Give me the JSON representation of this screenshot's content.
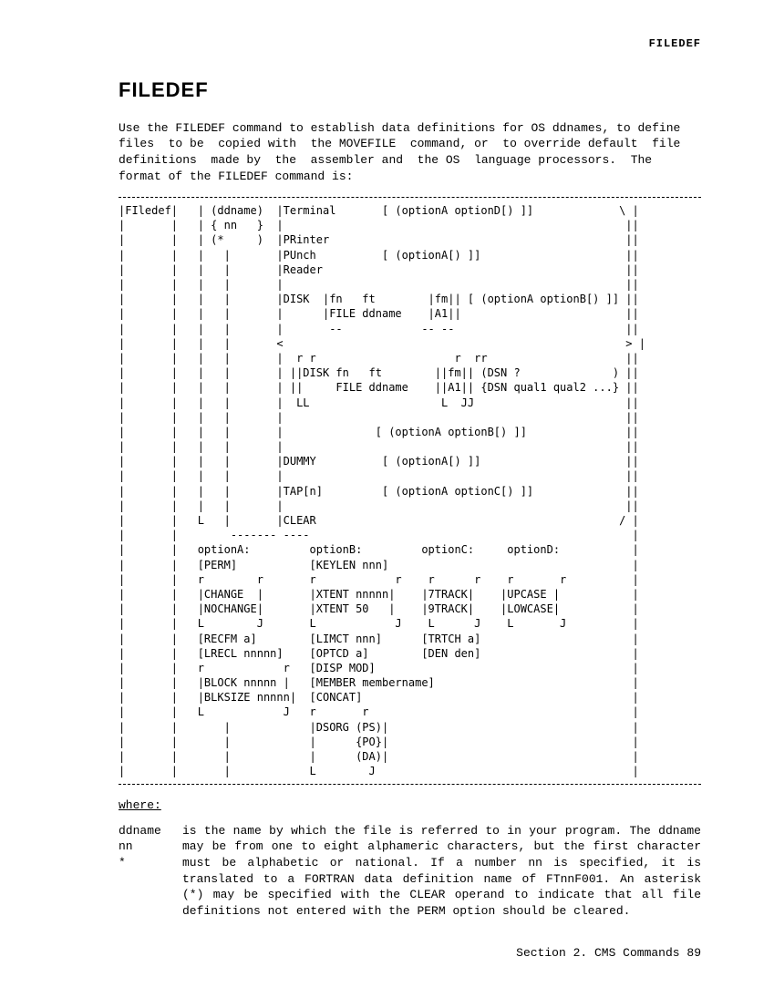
{
  "running_head": "FILEDEF",
  "title": "FILEDEF",
  "intro": "Use the FILEDEF command to establish data definitions for OS ddnames, to define files  to be  copied with  the MOVEFILE  command, or  to override default  file definitions  made by  the  assembler and  the OS  language processors.  The format of the FILEDEF command is:",
  "syntax": "|FIledef|   | (ddname)  |Terminal       [ (optionA optionD[) ]]             \\ |\n|       |   | { nn   }  |                                                    ||\n|       |   | (*     )  |PRinter                                             ||\n|       |   |   |       |PUnch          [ (optionA[) ]]                      ||\n|       |   |   |       |Reader                                              ||\n|       |   |   |       |                                                    ||\n|       |   |   |       |DISK  |fn   ft        |fm|| [ (optionA optionB[) ]] ||\n|       |   |   |       |      |FILE ddname    |A1||                         ||\n|       |   |   |       |       --            -- --                          ||\n|       |   |   |       <                                                    > |\n|       |   |   |       |  r r                     r  rr                     ||\n|       |   |   |       | ||DISK fn   ft        ||fm|| (DSN ?              ) ||\n|       |   |   |       | ||     FILE ddname    ||A1|| {DSN qual1 qual2 ...} ||\n|       |   |   |       |  LL                    L  JJ                       ||\n|       |   |   |       |                                                    ||\n|       |   |   |       |              [ (optionA optionB[) ]]               ||\n|       |   |   |       |                                                    ||\n|       |   |   |       |DUMMY          [ (optionA[) ]]                      ||\n|       |   |   |       |                                                    ||\n|       |   |   |       |TAP[n]         [ (optionA optionC[) ]]              ||\n|       |   |   |       |                                                    ||\n|       |   L   |       |CLEAR                                              / |\n|       |        ------- ----                                                 |\n|       |   optionA:         optionB:         optionC:     optionD:           |\n|       |   [PERM]           [KEYLEN nnn]                                     |\n|       |   r        r       r            r    r      r    r       r          |\n|       |   |CHANGE  |       |XTENT nnnnn|    |7TRACK|    |UPCASE |           |\n|       |   |NOCHANGE|       |XTENT 50   |    |9TRACK|    |LOWCASE|           |\n|       |   L        J       L            J    L      J    L       J          |\n|       |   [RECFM a]        [LIMCT nnn]      [TRTCH a]                       |\n|       |   [LRECL nnnnn]    [OPTCD a]        [DEN den]                       |\n|       |   r            r   [DISP MOD]                                       |\n|       |   |BLOCK nnnnn |   [MEMBER membername]                              |\n|       |   |BLKSIZE nnnnn|  [CONCAT]                                         |\n|       |   L            J   r       r                                        |\n|       |       |            |DSORG (PS)|                                     |\n|       |       |            |      {PO}|                                     |\n|       |       |            |      (DA)|                                     |\n|       |       |            L        J                                       |",
  "where_label": "where:",
  "def_terms": "ddname\nnn\n*",
  "def_body": "is the  name  by  which  the  file  is  referred  to  in  your program.  The  ddname may  be  from  one to  eight  alphameric characters,  but the  first character  must  be alphabetic  or national.  If a number nn is  specified, it is translated to a FORTRAN data definition name of FTnnF001.  An asterisk (*) may be specified with the CLEAR operand  to indicate that all file definitions  not  entered  with  the  PERM  option  should  be cleared.",
  "footer": "Section 2. CMS Commands  89"
}
